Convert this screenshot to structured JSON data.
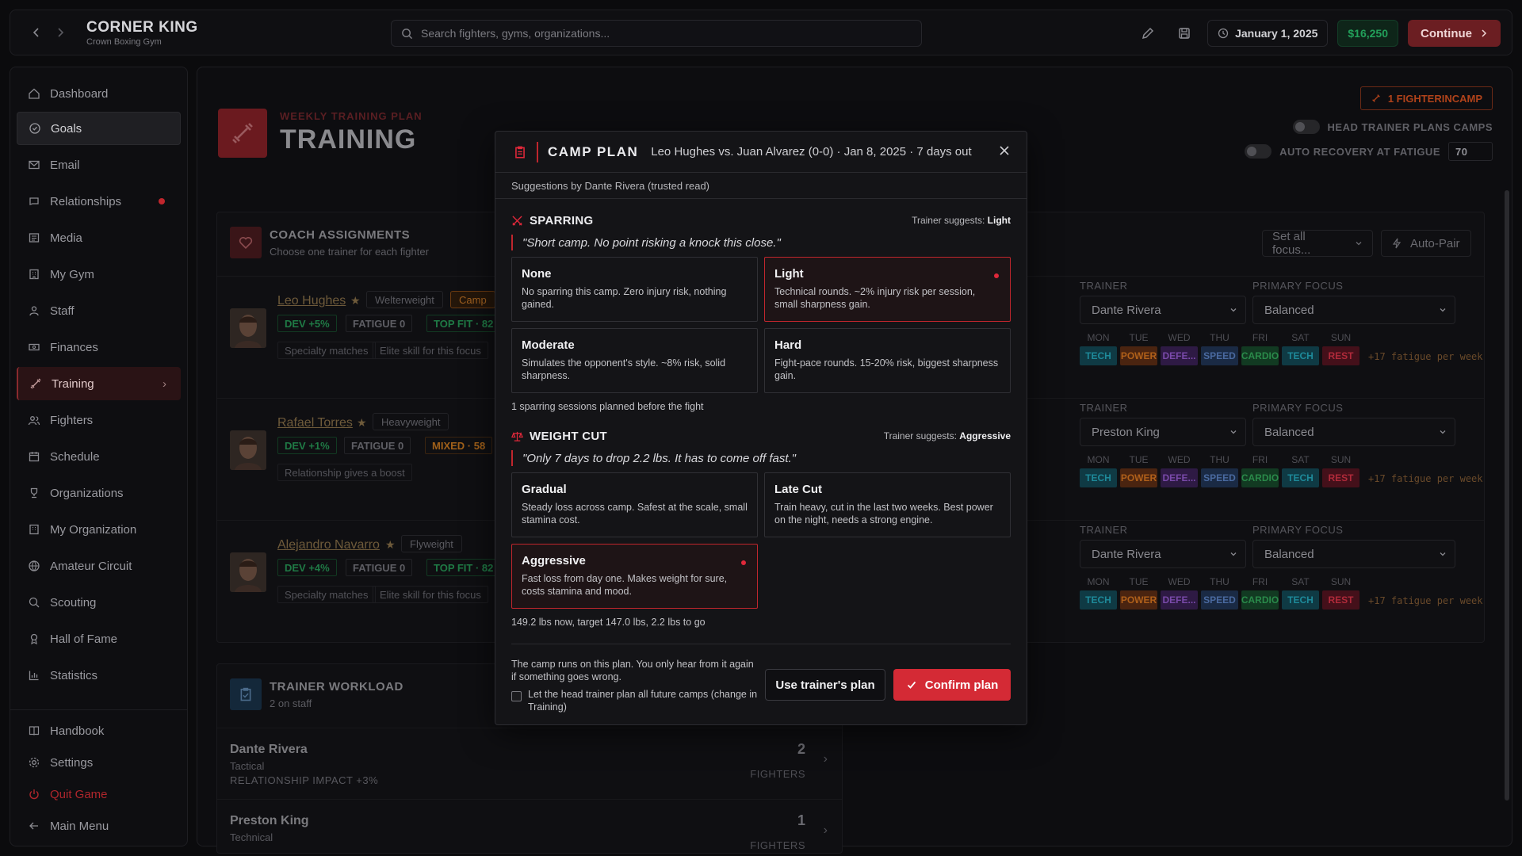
{
  "topbar": {
    "brand_title": "CORNER KING",
    "brand_subtitle": "Crown Boxing Gym",
    "search_placeholder": "Search fighters, gyms, organizations...",
    "date": "January 1, 2025",
    "money": "$16,250",
    "continue_label": "Continue"
  },
  "sidebar": {
    "items": [
      {
        "label": "Dashboard",
        "icon": "home-icon"
      },
      {
        "label": "Goals",
        "icon": "target-icon"
      },
      {
        "label": "Email",
        "icon": "mail-icon"
      },
      {
        "label": "Relationships",
        "icon": "chat-icon"
      },
      {
        "label": "Media",
        "icon": "newspaper-icon"
      },
      {
        "label": "My Gym",
        "icon": "building-icon"
      },
      {
        "label": "Staff",
        "icon": "staff-icon"
      },
      {
        "label": "Finances",
        "icon": "cash-icon"
      },
      {
        "label": "Training",
        "icon": "dumbbell-icon"
      },
      {
        "label": "Fighters",
        "icon": "users-icon"
      },
      {
        "label": "Schedule",
        "icon": "calendar-icon"
      },
      {
        "label": "Organizations",
        "icon": "trophy-icon"
      },
      {
        "label": "My Organization",
        "icon": "building-icon"
      },
      {
        "label": "Amateur Circuit",
        "icon": "globe-icon"
      },
      {
        "label": "Scouting",
        "icon": "search-icon"
      },
      {
        "label": "Hall of Fame",
        "icon": "award-icon"
      },
      {
        "label": "Statistics",
        "icon": "chart-icon"
      }
    ],
    "bottom": [
      {
        "label": "Handbook",
        "icon": "book-icon"
      },
      {
        "label": "Settings",
        "icon": "gear-icon"
      },
      {
        "label": "Quit Game",
        "icon": "power-icon"
      },
      {
        "label": "Main Menu",
        "icon": "arrow-left-icon"
      }
    ]
  },
  "main": {
    "hero_subtitle": "WEEKLY TRAINING PLAN",
    "hero_title": "TRAINING",
    "fighters_in_camp": "1 FIGHTERINCAMP",
    "toggle_head_trainer": "HEAD TRAINER PLANS CAMPS",
    "toggle_auto_recovery": "AUTO RECOVERY AT FATIGUE",
    "auto_recovery_value": "70",
    "coach": {
      "title": "COACH ASSIGNMENTS",
      "subtitle": "Choose one trainer for each fighter",
      "set_all": "Set all focus...",
      "auto_pair": "Auto-Pair",
      "trainer_label": "TRAINER",
      "focus_label": "PRIMARY FOCUS",
      "days": [
        "MON",
        "TUE",
        "WED",
        "THU",
        "FRI",
        "SAT",
        "SUN"
      ],
      "chips": [
        "TECH",
        "POWER",
        "DEFE...",
        "SPEED",
        "CARDIO",
        "TECH",
        "REST"
      ],
      "fatigue": "+17 fatigue per week",
      "rows": [
        {
          "name": "Leo Hughes",
          "weight": "Welterweight",
          "camp": "Camp",
          "dev": "DEV +5%",
          "fatigue": "FATIGUE 0",
          "fit": "TOP FIT · 82",
          "note1": "Specialty matches",
          "note2": "Elite skill for this focus",
          "trainer": "Dante Rivera",
          "focus": "Balanced"
        },
        {
          "name": "Rafael Torres",
          "weight": "Heavyweight",
          "dev": "DEV +1%",
          "fatigue": "FATIGUE 0",
          "fit": "MIXED · 58",
          "note1": "Relationship gives a boost",
          "trainer": "Preston King",
          "focus": "Balanced"
        },
        {
          "name": "Alejandro Navarro",
          "weight": "Flyweight",
          "dev": "DEV +4%",
          "fatigue": "FATIGUE 0",
          "fit": "TOP FIT · 82",
          "note1": "Specialty matches",
          "note2": "Elite skill for this focus",
          "trainer": "Dante Rivera",
          "focus": "Balanced"
        }
      ]
    },
    "workload": {
      "title": "TRAINER WORKLOAD",
      "subtitle": "2 on staff",
      "rows": [
        {
          "name": "Dante Rivera",
          "role": "Tactical",
          "impact": "RELATIONSHIP IMPACT +3%",
          "count": "2",
          "unit": "FIGHTERS"
        },
        {
          "name": "Preston King",
          "role": "Technical",
          "count": "1",
          "unit": "FIGHTERS"
        }
      ]
    }
  },
  "modal": {
    "title": "CAMP PLAN",
    "matchup": "Leo Hughes vs. Juan Alvarez (0-0) · Jan 8, 2025 · 7 days out",
    "suggestions_by": "Suggestions by Dante Rivera (trusted read)",
    "sparring": {
      "title": "SPARRING",
      "suggest_prefix": "Trainer suggests: ",
      "suggest_value": "Light",
      "quote": "\"Short camp. No point risking a knock this close.\"",
      "options": [
        {
          "name": "None",
          "desc": "No sparring this camp. Zero injury risk, nothing gained."
        },
        {
          "name": "Light",
          "desc": "Technical rounds. ~2% injury risk per session, small sharpness gain."
        },
        {
          "name": "Moderate",
          "desc": "Simulates the opponent's style. ~8% risk, solid sharpness."
        },
        {
          "name": "Hard",
          "desc": "Fight-pace rounds. 15-20% risk, biggest sharpness gain."
        }
      ],
      "info": "1 sparring sessions planned before the fight"
    },
    "weight_cut": {
      "title": "WEIGHT CUT",
      "suggest_prefix": "Trainer suggests: ",
      "suggest_value": "Aggressive",
      "quote": "\"Only 7 days to drop 2.2 lbs. It has to come off fast.\"",
      "options": [
        {
          "name": "Gradual",
          "desc": "Steady loss across camp. Safest at the scale, small stamina cost."
        },
        {
          "name": "Late Cut",
          "desc": "Train heavy, cut in the last two weeks. Best power on the night, needs a strong engine."
        },
        {
          "name": "Aggressive",
          "desc": "Fast loss from day one. Makes weight for sure, costs stamina and mood."
        }
      ],
      "info": "149.2 lbs now, target 147.0 lbs, 2.2 lbs to go"
    },
    "footer_text": "The camp runs on this plan. You only hear from it again if something goes wrong.",
    "checkbox_label": "Let the head trainer plan all future camps (change in Training)",
    "use_trainer_plan": "Use trainer's plan",
    "confirm_plan": "Confirm plan"
  }
}
